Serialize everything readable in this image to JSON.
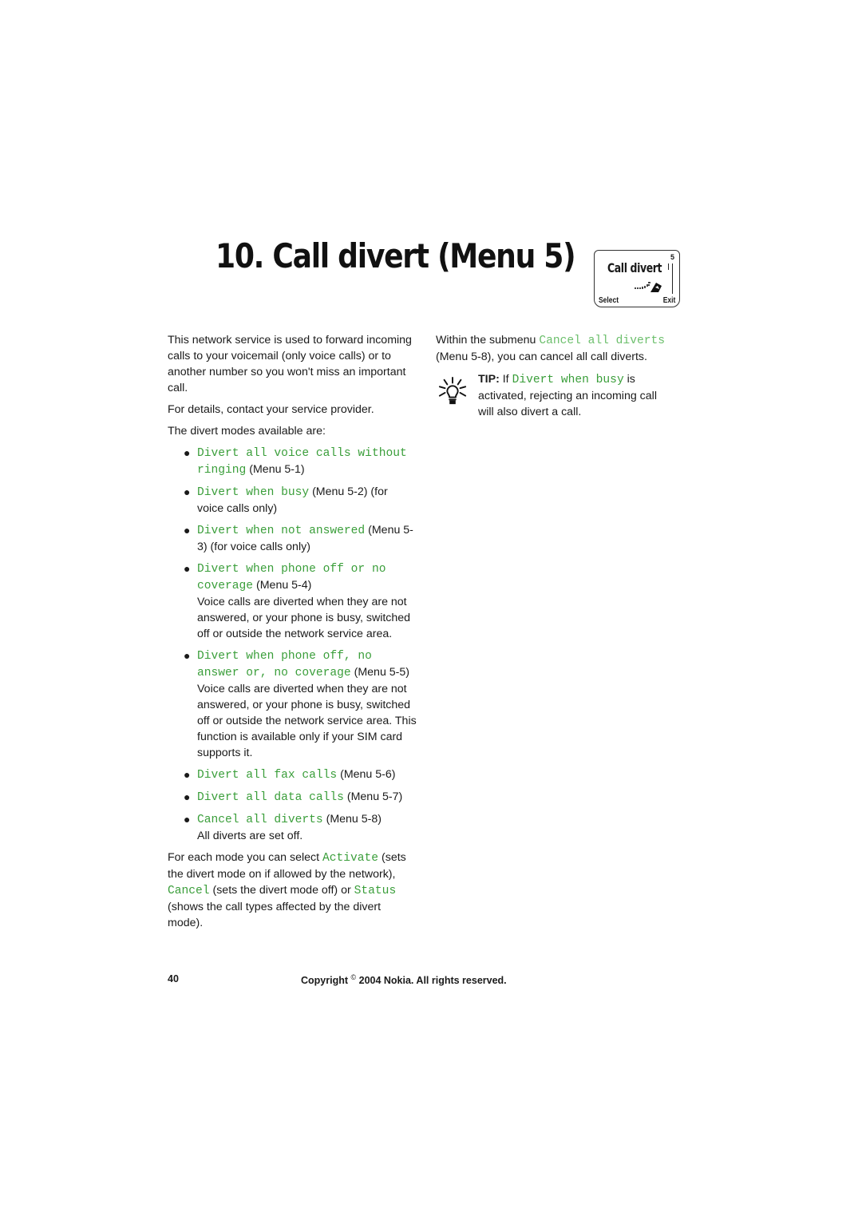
{
  "page": {
    "title": "10. Call divert (Menu 5)",
    "phone_screen": {
      "title": "Call divert",
      "menu_number": "5",
      "left_softkey": "Select",
      "right_softkey": "Exit",
      "icon": "call-divert-icon"
    },
    "intro": "This network service is used to forward incoming calls to your voicemail (only voice calls) or to another number so you won't miss an important call.",
    "details": "For details, contact your service provider.",
    "modes_heading": "The divert modes available are:",
    "modes": [
      {
        "name": "Divert all voice calls without ringing",
        "menu": "(Menu 5-1)",
        "note": ""
      },
      {
        "name": "Divert when busy",
        "menu": "(Menu 5-2) (for voice calls only)",
        "note": ""
      },
      {
        "name": "Divert when not answered",
        "menu": "(Menu 5-3) (for voice calls only)",
        "note": ""
      },
      {
        "name": "Divert when phone off or no coverage",
        "menu": "(Menu 5-4)",
        "note": "Voice calls are diverted when they are not answered, or your phone is busy, switched off or outside the network service area."
      },
      {
        "name": "Divert when phone off, no answer or, no coverage",
        "menu": "(Menu 5-5)",
        "note": "Voice calls are diverted when they are not answered, or your phone is busy, switched off or outside the network service area. This function is available only if your SIM card supports it."
      },
      {
        "name": "Divert all fax calls",
        "menu": "(Menu 5-6)",
        "note": ""
      },
      {
        "name": "Divert all data calls",
        "menu": "(Menu 5-7)",
        "note": ""
      },
      {
        "name": "Cancel all diverts",
        "menu": "(Menu 5-8)",
        "note": "All diverts are set off."
      }
    ],
    "options_paragraph": {
      "p1": "For each mode you can select ",
      "activate": "Activate",
      "p2": " (sets the divert mode on if allowed by the network), ",
      "cancel": "Cancel",
      "p3": " (sets the divert mode off) or ",
      "status": "Status",
      "p4": " (shows the call types affected by the divert mode)."
    },
    "right_column": {
      "p1": "Within the submenu ",
      "submenu": "Cancel all diverts",
      "p2": " (Menu 5-8), you can cancel all call diverts.",
      "tip_label": "TIP:",
      "tip_p1": " If ",
      "tip_term": "Divert when busy",
      "tip_p2": " is activated, rejecting an incoming call will also divert a call.",
      "tip_icon": "lightbulb-icon"
    },
    "footer": {
      "page_number": "40",
      "copyright_prefix": "Copyright ",
      "copyright_symbol": "©",
      "copyright_suffix": " 2004 Nokia. All rights reserved."
    },
    "colors": {
      "menu_text_green": "#3a9e3a",
      "body_text": "#1a1a1a"
    }
  }
}
